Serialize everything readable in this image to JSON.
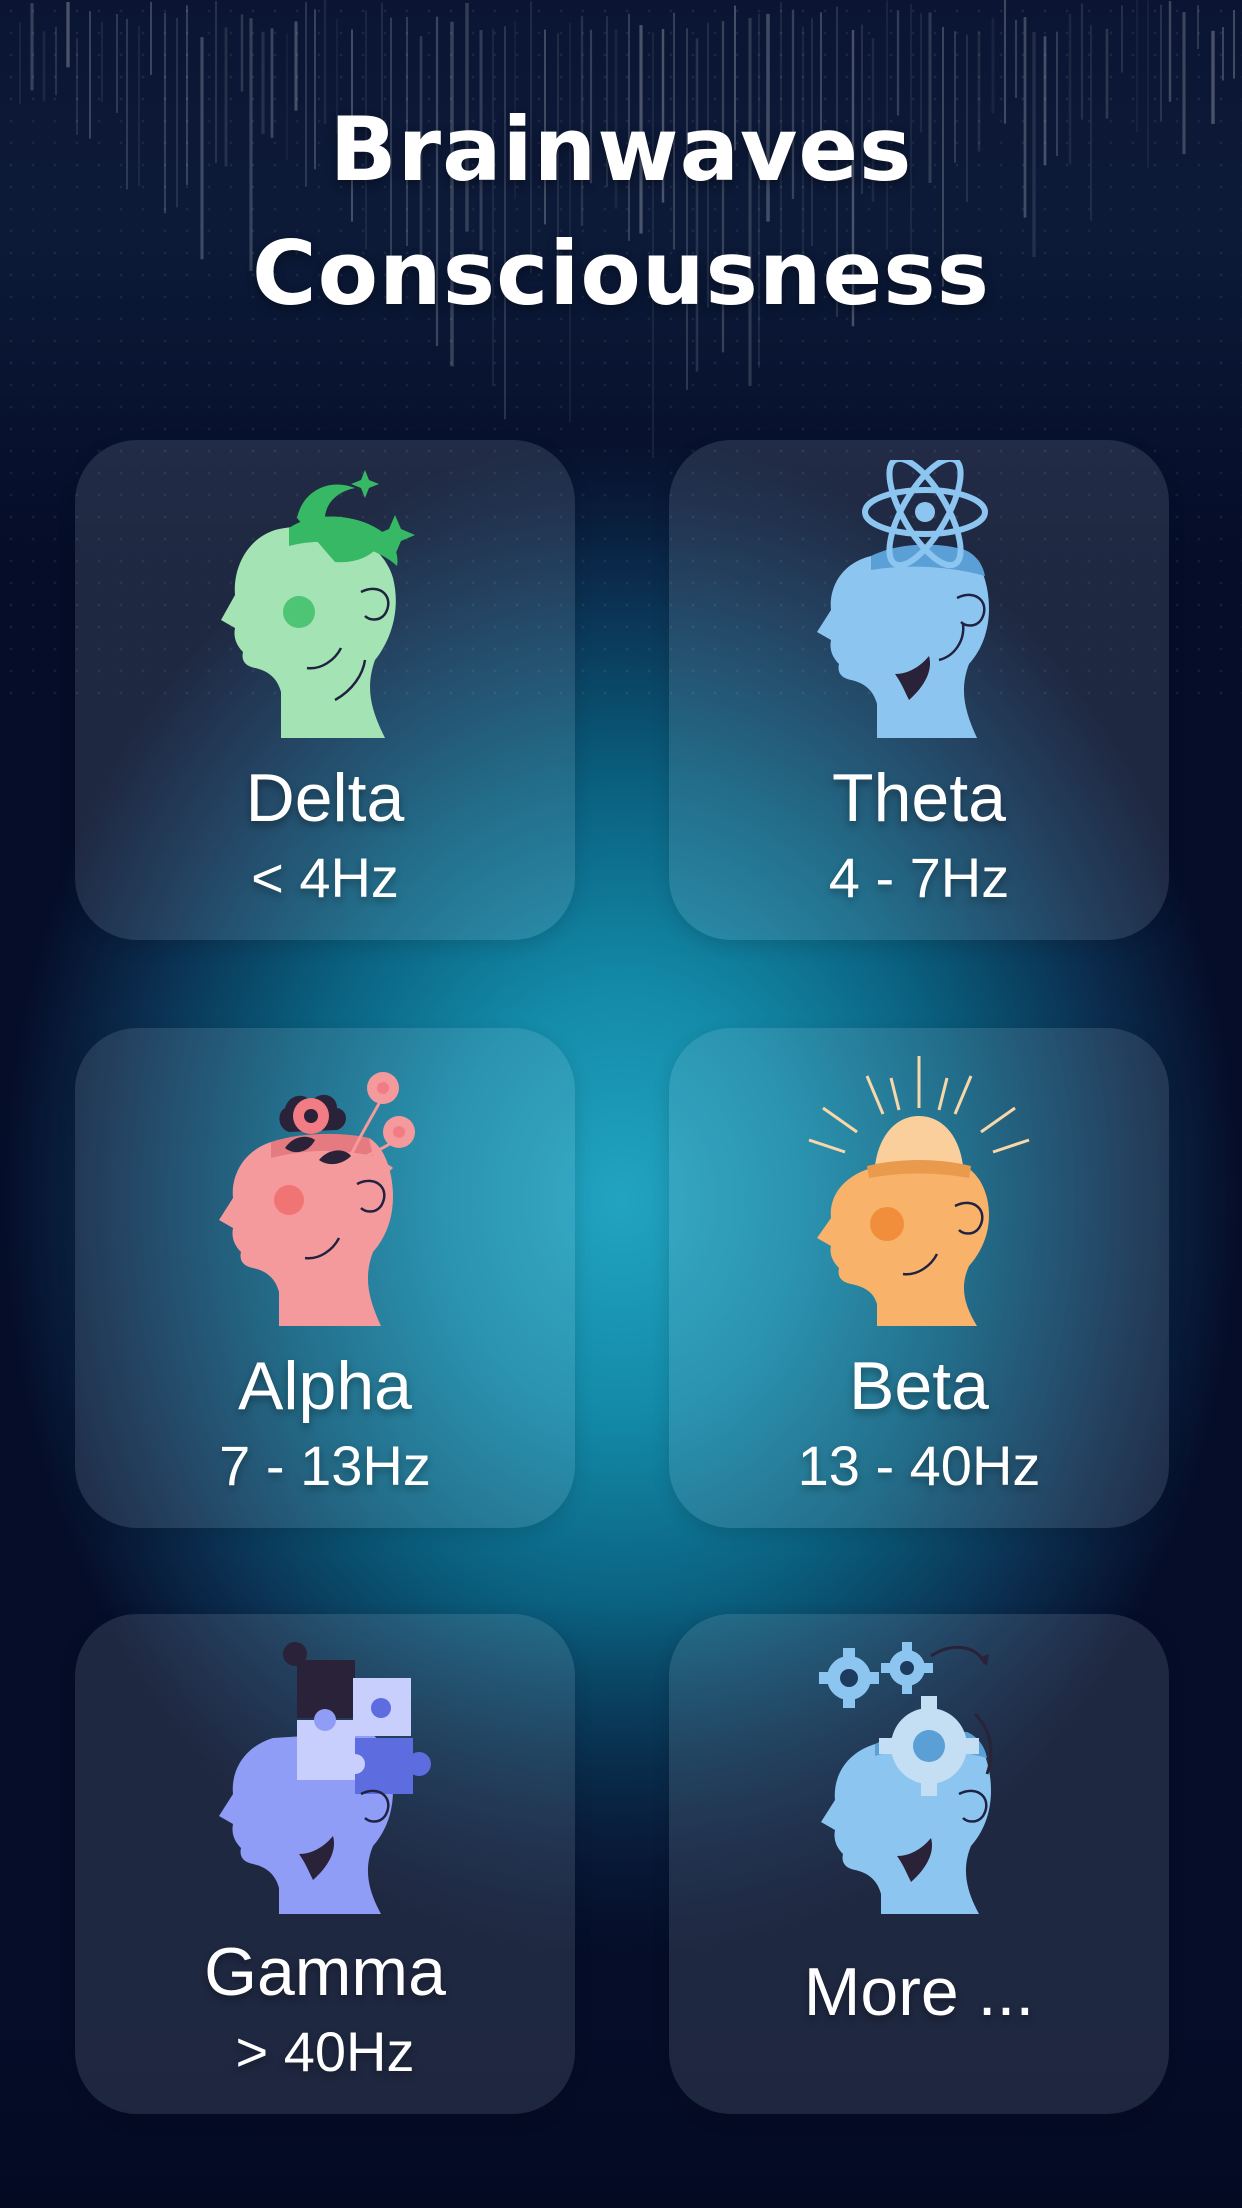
{
  "header": {
    "title_line1": "Brainwaves",
    "title_line2": "Consciousness"
  },
  "cards": [
    {
      "name": "Delta",
      "freq": "< 4Hz",
      "icon": "moon-stars-head-icon",
      "color": "#a4e3b4"
    },
    {
      "name": "Theta",
      "freq": "4 - 7Hz",
      "icon": "atom-head-icon",
      "color": "#8cc6f0"
    },
    {
      "name": "Alpha",
      "freq": "7 - 13Hz",
      "icon": "flower-head-icon",
      "color": "#f59a9c"
    },
    {
      "name": "Beta",
      "freq": "13 - 40Hz",
      "icon": "sun-head-icon",
      "color": "#f8b26a"
    },
    {
      "name": "Gamma",
      "freq": "> 40Hz",
      "icon": "puzzle-head-icon",
      "color": "#8f9df7"
    },
    {
      "name": "More ...",
      "freq": "",
      "icon": "gears-head-icon",
      "color": "#8cc6f0"
    }
  ],
  "colors": {
    "background_center": "#22a4c1",
    "background_edge": "#050d28",
    "card_fill": "rgba(210,225,240,0.13)",
    "text": "#ffffff"
  }
}
